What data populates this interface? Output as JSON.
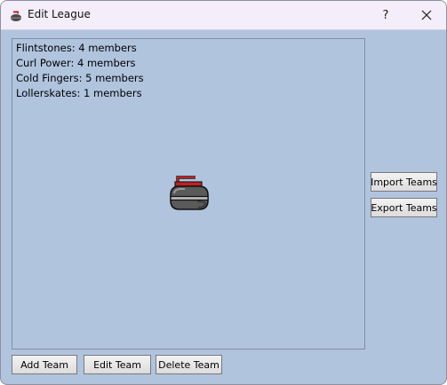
{
  "window": {
    "title": "Edit League",
    "icon": "curling-stone-icon",
    "help_glyph": "?",
    "close_icon": "close-icon"
  },
  "teams": [
    {
      "label": "Flintstones: 4 members"
    },
    {
      "label": "Curl Power: 4 members"
    },
    {
      "label": "Cold Fingers: 5 members"
    },
    {
      "label": "Lollerskates: 1 members"
    }
  ],
  "side_buttons": {
    "import_label": "Import Teams",
    "export_label": "Export Teams"
  },
  "bottom_buttons": {
    "add_label": "Add Team",
    "edit_label": "Edit Team",
    "delete_label": "Delete Team"
  },
  "colors": {
    "background": "#b0c4de",
    "titlebar": "#f3eef9",
    "stone_body": "#4a4a4a",
    "stone_band": "#808080",
    "stone_handle": "#c21f1f"
  }
}
